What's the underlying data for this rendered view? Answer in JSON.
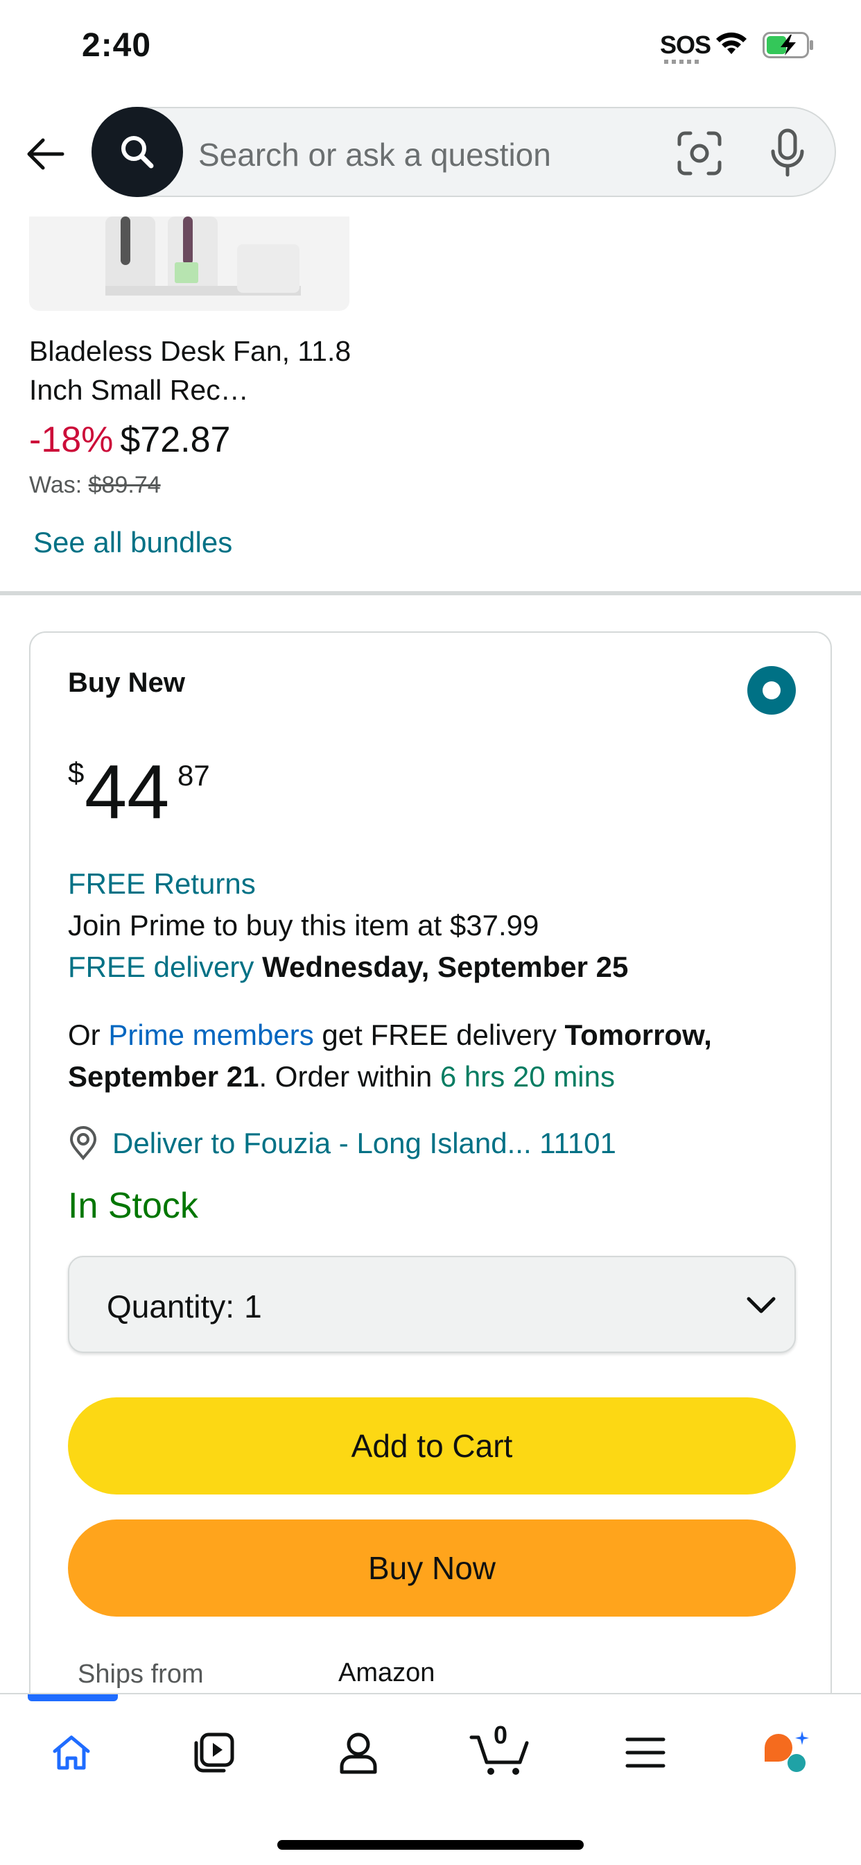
{
  "status_bar": {
    "time": "2:40",
    "sos": "SOS"
  },
  "search": {
    "placeholder": "Search or ask a question"
  },
  "product": {
    "title": "Bladeless Desk Fan, 11.8 Inch Small Rec…",
    "discount": "-18%",
    "price": "$72.87",
    "was_label": "Was:",
    "was_price": "$89.74",
    "see_all": "See all bundles"
  },
  "buy_box": {
    "label": "Buy New",
    "price_symbol": "$",
    "price_whole": "44",
    "price_fraction": "87",
    "free_returns": "FREE Returns",
    "join_prime": "Join Prime to buy this item at $37.99",
    "free_delivery_link": "FREE delivery",
    "free_delivery_date": "Wednesday, September 25",
    "or_text": "Or",
    "prime_members_link": "Prime members",
    "prime_text": "get FREE delivery",
    "prime_date": "Tomorrow, September 21",
    "order_within_text": ". Order within",
    "order_within_time": "6 hrs 20 mins",
    "deliver_to": "Deliver to Fouzia - Long Island... 11101",
    "stock": "In Stock",
    "quantity_label": "Quantity:",
    "quantity_value": "1",
    "add_to_cart": "Add to Cart",
    "buy_now": "Buy Now",
    "ships_from_label": "Ships from",
    "ships_from_value": "Amazon"
  },
  "bottom_nav": {
    "items": [
      "home-icon",
      "video-icon",
      "account-icon",
      "cart-icon",
      "menu-icon",
      "rufus-icon"
    ],
    "cart_count": "0"
  },
  "colors": {
    "link": "#007185",
    "prime_link": "#0066c0",
    "discount": "#cc0c39",
    "in_stock": "#007600",
    "add_to_cart": "#fcd814",
    "buy_now": "#ffa41c",
    "nav_active": "#1f6cff"
  }
}
